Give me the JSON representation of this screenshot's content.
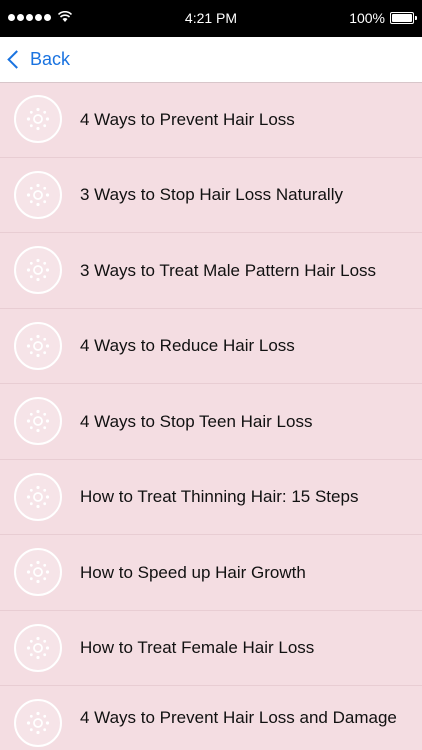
{
  "status": {
    "time": "4:21 PM",
    "battery_text": "100%",
    "battery_level": 1.0
  },
  "nav": {
    "back_label": "Back"
  },
  "list": {
    "items": [
      {
        "label": "4 Ways to Prevent Hair Loss",
        "icon": "flower-icon"
      },
      {
        "label": "3 Ways to Stop Hair Loss Naturally",
        "icon": "flower-icon"
      },
      {
        "label": "3 Ways to Treat Male Pattern Hair Loss",
        "icon": "flower-icon"
      },
      {
        "label": "4 Ways to Reduce Hair Loss",
        "icon": "flower-icon"
      },
      {
        "label": "4 Ways to Stop Teen Hair Loss",
        "icon": "flower-icon"
      },
      {
        "label": "How to Treat Thinning Hair: 15 Steps",
        "icon": "flower-icon"
      },
      {
        "label": "How to Speed up Hair Growth",
        "icon": "flower-icon"
      },
      {
        "label": "How to Treat Female Hair Loss",
        "icon": "flower-icon"
      },
      {
        "label": "4 Ways to Prevent Hair Loss and Damage",
        "icon": "flower-icon"
      }
    ]
  },
  "colors": {
    "background": "#f4dde2",
    "accent": "#1a73e0",
    "status_bar": "#000000"
  }
}
